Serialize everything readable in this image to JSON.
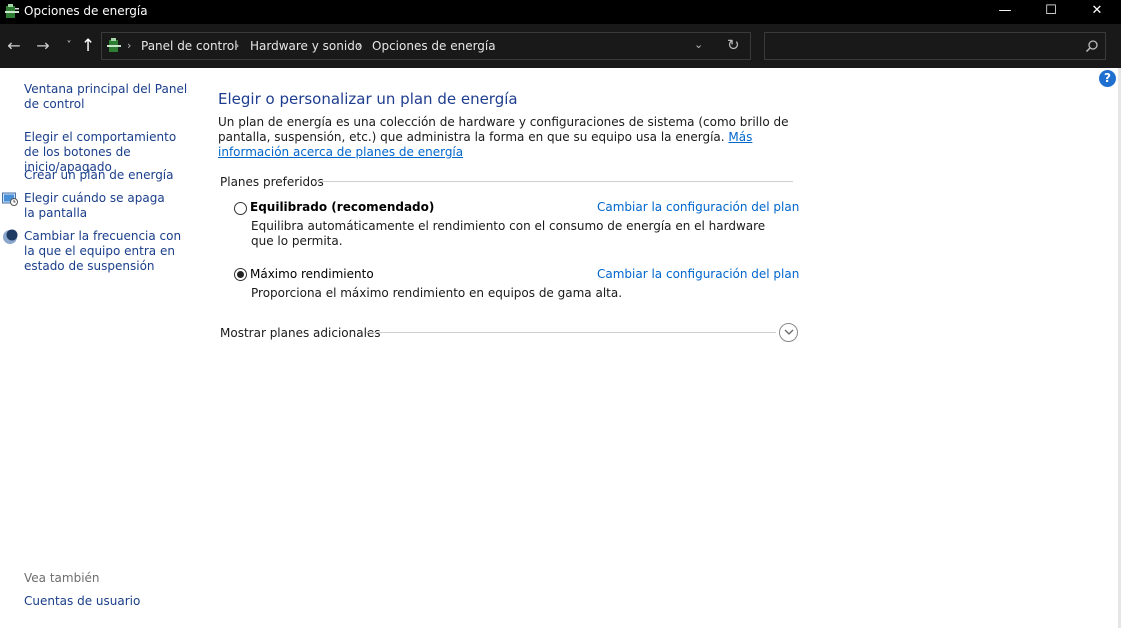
{
  "window": {
    "title": "Opciones de energía",
    "minimize_glyph": "—",
    "maximize_glyph": "☐",
    "close_glyph": "✕"
  },
  "nav": {
    "back_glyph": "←",
    "forward_glyph": "→",
    "recent_glyph": "˅",
    "up_glyph": "↑",
    "breadcrumb": [
      "Panel de control",
      "Hardware y sonido",
      "Opciones de energía"
    ],
    "separator": "›",
    "dropdown_glyph": "⌄",
    "refresh_glyph": "↻",
    "search_value": ""
  },
  "sidebar": {
    "links": [
      "Ventana principal del Panel de control",
      "Elegir el comportamiento de los botones de inicio/apagado",
      "Crear un plan de energía",
      "Elegir cuándo se apaga la pantalla",
      "Cambiar la frecuencia con la que el equipo entra en estado de suspensión"
    ],
    "see_also_label": "Vea también",
    "see_also_link": "Cuentas de usuario"
  },
  "main": {
    "help_glyph": "?",
    "heading": "Elegir o personalizar un plan de energía",
    "intro_text": "Un plan de energía es una colección de hardware y configuraciones de sistema (como brillo de pantalla, suspensión, etc.) que administra la forma en que su equipo usa la energía.",
    "intro_link": "Más información acerca de planes de energía",
    "group_label": "Planes preferidos",
    "plans": [
      {
        "name": "Equilibrado (recomendado)",
        "description": "Equilibra automáticamente el rendimiento con el consumo de energía en el hardware que lo permita.",
        "change_link": "Cambiar la configuración del plan",
        "selected": false
      },
      {
        "name": "Máximo rendimiento",
        "description": "Proporciona el máximo rendimiento en equipos de gama alta.",
        "change_link": "Cambiar la configuración del plan",
        "selected": true
      }
    ],
    "more_plans_label": "Mostrar planes adicionales"
  },
  "colors": {
    "link": "#0066cc",
    "heading": "#1e3d8f",
    "sidebar_link": "#1a3e8a",
    "titlebar": "#000000",
    "addressbar": "#191919"
  }
}
